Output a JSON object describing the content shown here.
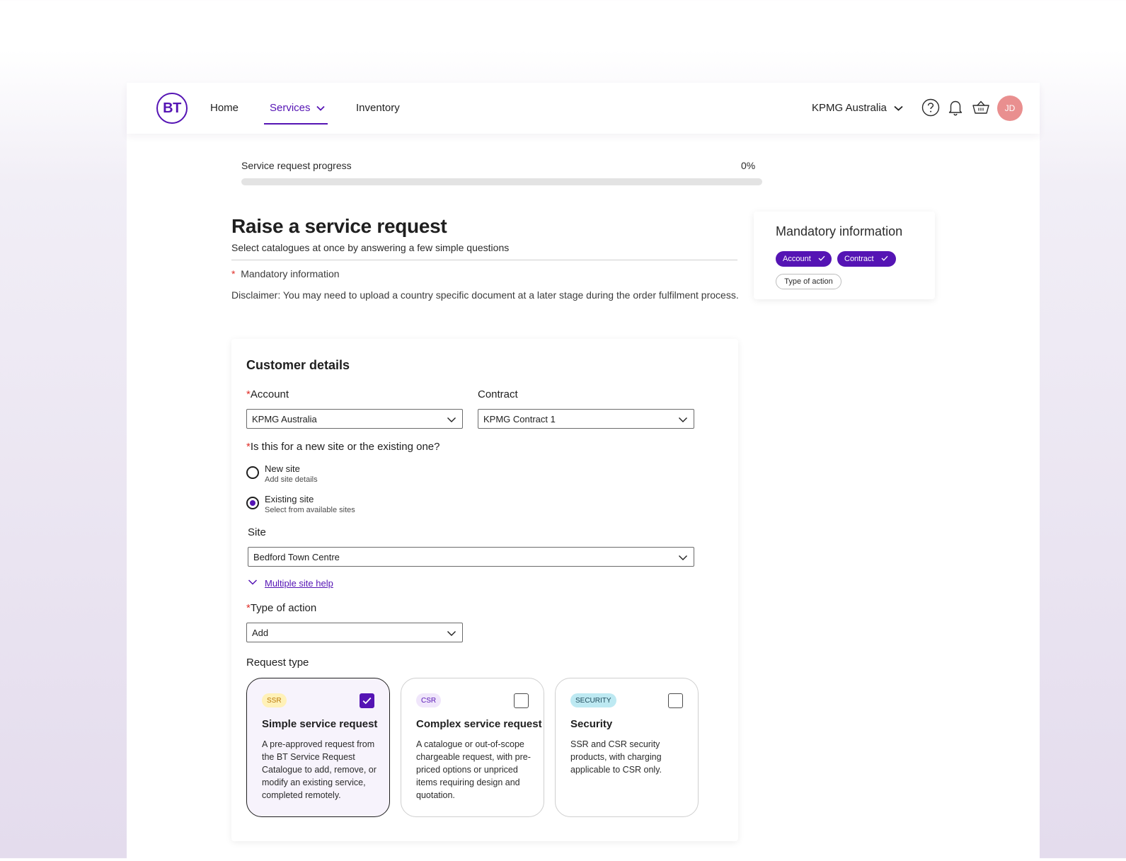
{
  "header": {
    "logo_text": "BT",
    "nav": [
      {
        "label": "Home"
      },
      {
        "label": "Services"
      },
      {
        "label": "Inventory"
      }
    ],
    "org_select": "KPMG Australia",
    "avatar_initials": "JD",
    "icons": [
      "help-icon",
      "bell-icon",
      "basket-icon",
      "chevron-down-icon"
    ]
  },
  "progress": {
    "label": "Service request progress",
    "value_text": "0%",
    "percent": 0
  },
  "page": {
    "title": "Raise a service request",
    "subtitle": "Select catalogues at once by answering a  few simple questions",
    "mandatory_star": "*",
    "mandatory_note": "Mandatory information",
    "disclaimer": "Disclaimer: You may need to upload a country specific document at a later stage during the order fulfilment process."
  },
  "side_card": {
    "title": "Mandatory information",
    "chips": [
      {
        "label": "Account",
        "done": true
      },
      {
        "label": "Contract",
        "done": true
      },
      {
        "label": "Type of action",
        "done": false
      }
    ]
  },
  "form": {
    "section_title": "Customer details",
    "req_star": "*",
    "account_label": "Account",
    "account_value": "KPMG Australia",
    "contract_label": "Contract",
    "contract_value": "KPMG Contract 1",
    "site_question": "Is this for a new site or the existing one?",
    "radio_new": {
      "label": "New site",
      "sub": "Add site details",
      "selected": false
    },
    "radio_existing": {
      "label": "Existing site",
      "sub": "Select from available sites",
      "selected": true
    },
    "site_label": "Site",
    "site_value": "Bedford Town Centre",
    "site_help_link": "Multiple site help",
    "action_label": "Type of action",
    "action_value": "Add",
    "request_type_label": "Request type",
    "request_types": [
      {
        "badge": "SSR",
        "title": "Simple service request",
        "description": "A pre-approved request from the BT Service Request Catalogue to add, remove, or modify an existing service, completed remotely.",
        "checked": true
      },
      {
        "badge": "CSR",
        "title": "Complex service request",
        "description": "A catalogue or out-of-scope chargeable request, with pre-priced options or unpriced items requiring design and quotation.",
        "checked": false
      },
      {
        "badge": "SECURITY",
        "title": "Security",
        "description": "SSR and CSR security products, with charging applicable to CSR only.",
        "checked": false
      }
    ]
  },
  "colors": {
    "brand": "#5514b4",
    "required": "#e0302a",
    "avatar": "#e98f8f"
  }
}
